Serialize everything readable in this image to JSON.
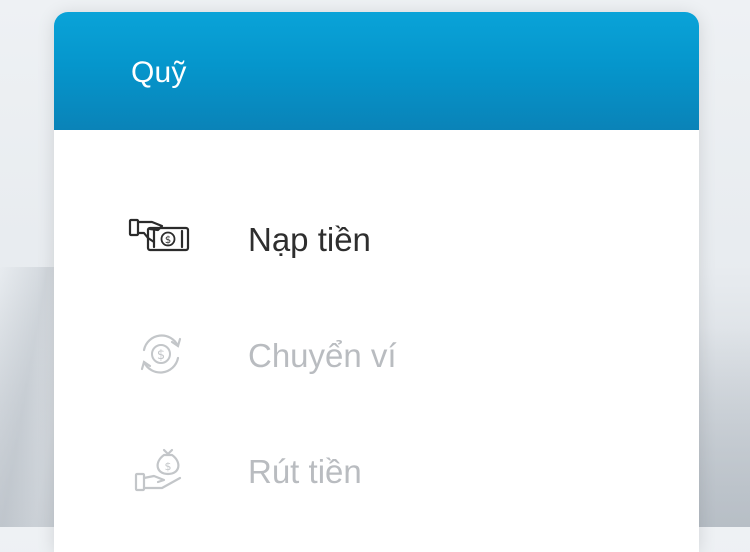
{
  "panel": {
    "title": "Quỹ"
  },
  "menu": {
    "items": [
      {
        "label": "Nạp tiền",
        "icon": "cash-deposit-icon",
        "state": "active"
      },
      {
        "label": "Chuyển ví",
        "icon": "wallet-transfer-icon",
        "state": "disabled"
      },
      {
        "label": "Rút tiền",
        "icon": "money-bag-withdraw-icon",
        "state": "disabled"
      }
    ]
  },
  "colors": {
    "header_top": "#0aa3d8",
    "header_bottom": "#0a83b8",
    "active_text": "#2e2e2e",
    "disabled_text": "#b9bcc0"
  }
}
